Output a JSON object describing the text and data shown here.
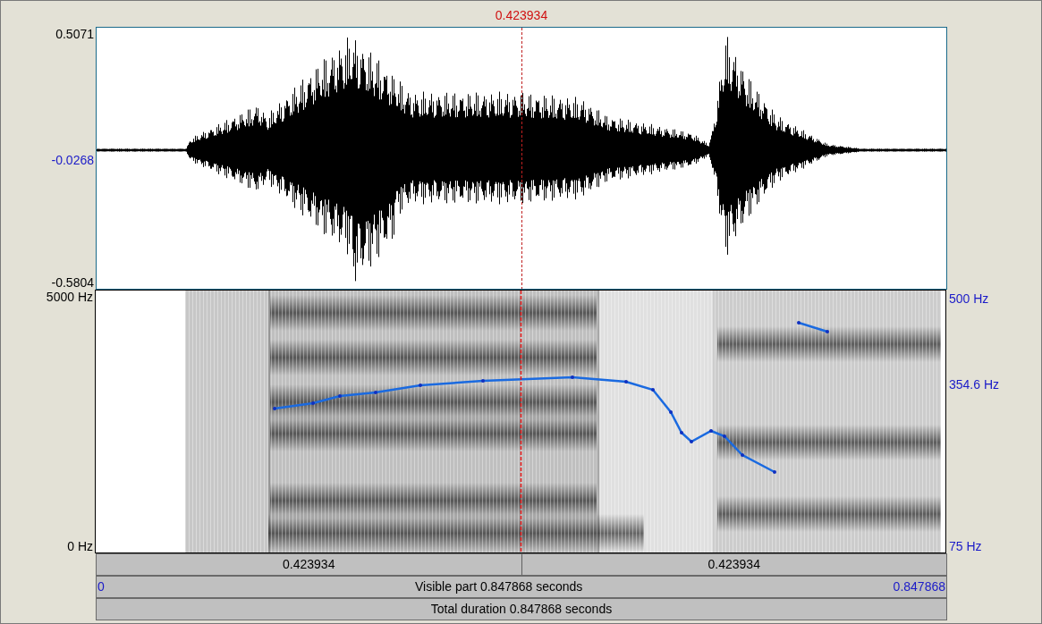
{
  "cursor": {
    "time": "0.423934"
  },
  "waveform": {
    "y_max": "0.5071",
    "y_mid": "-0.0268",
    "y_min": "-0.5804"
  },
  "spectrogram": {
    "freq_max": "5000 Hz",
    "freq_min": "0 Hz",
    "pitch_max": "500 Hz",
    "pitch_mid": "354.6 Hz",
    "pitch_min": "75 Hz"
  },
  "time_bars": [
    {
      "kind": "halves",
      "texts": [
        "0.423934",
        "0.423934"
      ]
    },
    {
      "kind": "visible",
      "start": "0",
      "label": "Visible part 0.847868 seconds",
      "end": "0.847868"
    },
    {
      "kind": "total",
      "label": "Total duration 0.847868 seconds"
    }
  ]
}
